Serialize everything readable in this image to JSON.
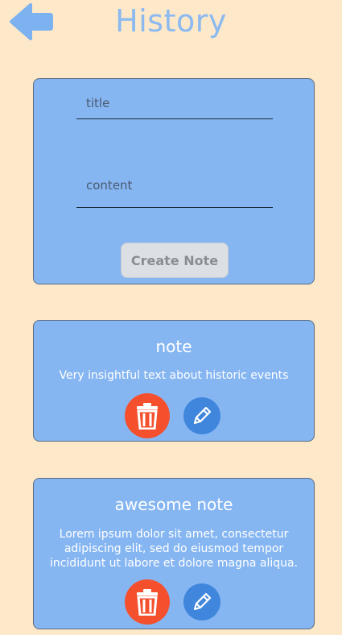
{
  "header": {
    "title": "History",
    "back_icon": "arrow-left-icon",
    "back_color": "#7cb2f0"
  },
  "form": {
    "title_placeholder": "title",
    "content_placeholder": "content",
    "create_label": "Create Note"
  },
  "notes": [
    {
      "title": "note",
      "body": "Very insightful  text about historic events",
      "delete_icon": "trash-icon",
      "edit_icon": "pencil-icon"
    },
    {
      "title": "awesome note",
      "body": "Lorem ipsum dolor sit amet, consectetur adipiscing elit, sed do eiusmod tempor incididunt ut labore et dolore magna aliqua.",
      "delete_icon": "trash-icon",
      "edit_icon": "pencil-icon"
    }
  ],
  "colors": {
    "background": "#fde9c9",
    "card": "#86b6f2",
    "delete": "#f4502e",
    "edit": "#3f86dc",
    "title": "#8bb9f0"
  }
}
